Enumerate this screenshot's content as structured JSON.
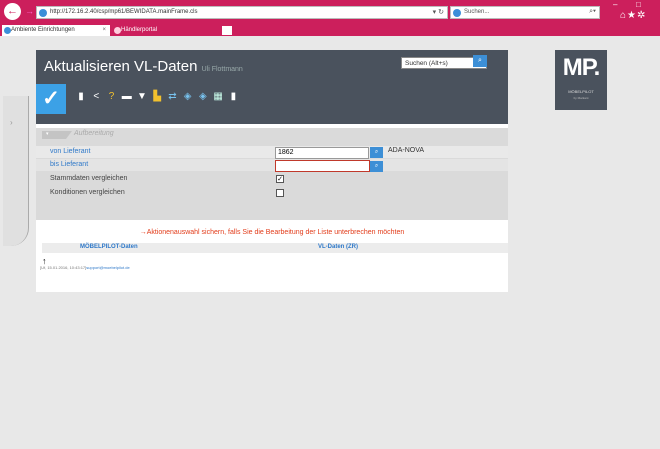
{
  "browser": {
    "url": "http://172.16.2.40/csp/mp61/BEWIDATA.mainFrame.cls",
    "search_placeholder": "Suchen...",
    "tabs": [
      {
        "label": "Ambiente Einrichtungen"
      },
      {
        "label": "Händlerportal"
      }
    ]
  },
  "app": {
    "title": "Aktualisieren VL-Daten",
    "user": "Uli Flottmann",
    "search_label": "Suchen (Alt+s)",
    "logo": {
      "text": "MP.",
      "sub": "MÖBELPILOT",
      "sub2": "by Markant"
    }
  },
  "form": {
    "section_title": "Aufbereitung",
    "fields": {
      "von_lieferant": {
        "label": "von Lieferant",
        "value": "1862",
        "display": "ADA-NOVA"
      },
      "bis_lieferant": {
        "label": "bis Lieferant",
        "value": ""
      },
      "stammdaten": {
        "label": "Stammdaten vergleichen",
        "checked": "✓"
      },
      "konditionen": {
        "label": "Konditionen vergleichen",
        "checked": ""
      }
    }
  },
  "note": "→Aktionenauswahl sichern, falls Sie die Bearbeitung der Liste unterbrechen möchten",
  "table": {
    "columns": [
      "MÖBELPILOT-Daten",
      "VL-Daten (ZR)"
    ]
  },
  "footer": {
    "meta": "[Uf, 15.01.2016, 10:43:17]",
    "email": "support@moebelpilot.de"
  },
  "colors": {
    "accent": "#cc1f5c",
    "header": "#4a525d",
    "link": "#2f79c9",
    "highlight": "#c0392b"
  }
}
